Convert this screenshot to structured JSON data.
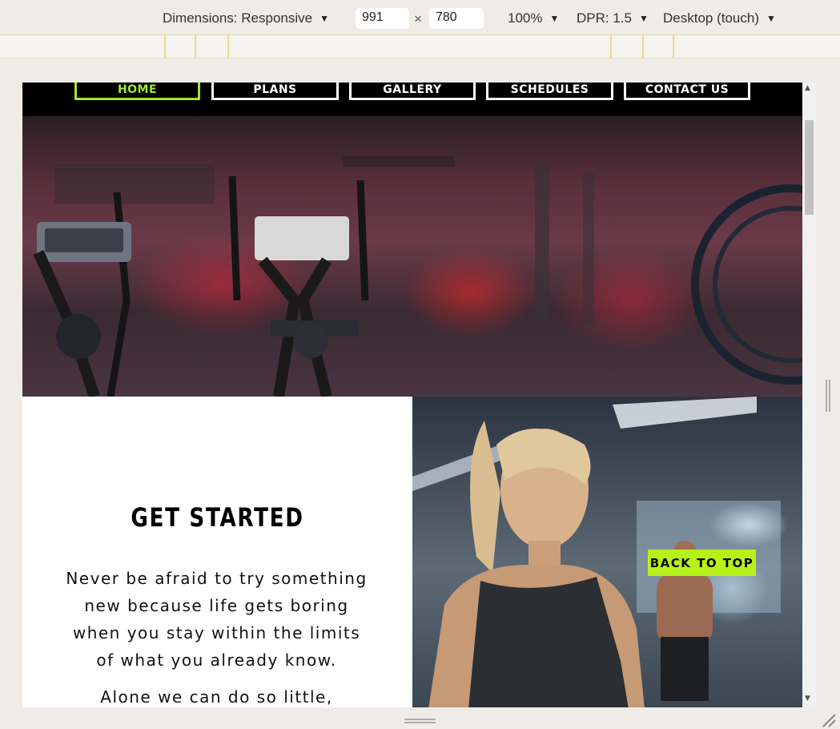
{
  "devtools": {
    "dimensions_label": "Dimensions: Responsive",
    "width_value": "991",
    "times_sign": "×",
    "height_value": "780",
    "zoom": "100%",
    "dpr": "DPR: 1.5",
    "device_type": "Desktop (touch)",
    "caret": "▼"
  },
  "scrollbar": {
    "up": "▲",
    "down": "▼"
  },
  "nav": {
    "items": [
      {
        "label": "HOME",
        "active": true
      },
      {
        "label": "PLANS",
        "active": false
      },
      {
        "label": "GALLERY",
        "active": false
      },
      {
        "label": "SCHEDULES",
        "active": false
      },
      {
        "label": "CONTACT US",
        "active": false
      }
    ]
  },
  "intro": {
    "title": "GET STARTED",
    "quote": "Never be afraid to try something new because life gets boring when you stay within the limits of what you already know.",
    "quote2": "Alone we can do so little,"
  },
  "back_to_top": "BACK TO TOP",
  "colors": {
    "accent": "#a4e82a",
    "back_to_top_bg": "#b6f21a",
    "nav_bg": "#000000"
  }
}
